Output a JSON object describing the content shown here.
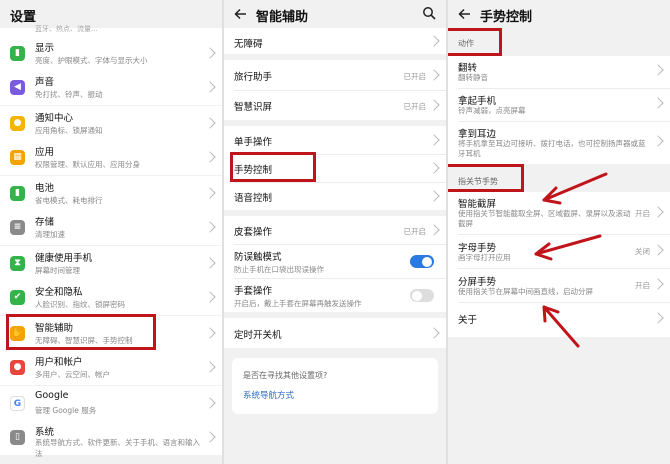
{
  "panel1": {
    "title": "设置",
    "top_fragment": "蓝牙、热点、流量...",
    "items": [
      {
        "title": "显示",
        "subtitle": "亮度、护眼模式、字体与显示大小",
        "icon": "display-icon",
        "color": "#33b34a"
      },
      {
        "title": "声音",
        "subtitle": "免打扰、铃声、振动",
        "icon": "sound-icon",
        "color": "#7a5ae0"
      },
      {
        "title": "通知中心",
        "subtitle": "应用角标、锁屏通知",
        "icon": "notification-icon",
        "color": "#f4b400"
      },
      {
        "title": "应用",
        "subtitle": "权限管理、默认应用、应用分身",
        "icon": "apps-icon",
        "color": "#f4a300"
      },
      {
        "title": "电池",
        "subtitle": "省电模式、耗电排行",
        "icon": "battery-icon",
        "color": "#33b34a"
      },
      {
        "title": "存储",
        "subtitle": "清理加速",
        "icon": "storage-icon",
        "color": "#8a8a8a"
      },
      {
        "title": "健康使用手机",
        "subtitle": "屏幕时间管理",
        "icon": "hourglass-icon",
        "color": "#33b34a"
      },
      {
        "title": "安全和隐私",
        "subtitle": "人脸识别、指纹、锁屏密码",
        "icon": "shield-icon",
        "color": "#33b34a"
      },
      {
        "title": "智能辅助",
        "subtitle": "无障碍、智慧识屏、手势控制",
        "icon": "hand-icon",
        "color": "#f4a300"
      },
      {
        "title": "用户和帐户",
        "subtitle": "多用户、云空间、帐户",
        "icon": "user-icon",
        "color": "#e8453c"
      },
      {
        "title": "Google",
        "subtitle": "管理 Google 服务",
        "icon": "google-icon",
        "color": "#ffffff"
      },
      {
        "title": "系统",
        "subtitle": "系统导航方式、软件更新、关于手机、语言和输入法",
        "icon": "system-icon",
        "color": "#8a8a8a"
      }
    ]
  },
  "panel2": {
    "title": "智能辅助",
    "items": [
      {
        "title": "无障碍"
      },
      {
        "title": "旅行助手",
        "value": "已开启"
      },
      {
        "title": "智慧识屏",
        "value": "已开启"
      },
      {
        "title": "单手操作"
      },
      {
        "title": "手势控制"
      },
      {
        "title": "语音控制"
      },
      {
        "title": "皮套操作",
        "value": "已开启"
      },
      {
        "title": "防误触模式",
        "subtitle": "防止手机在口袋出现误操作",
        "toggle": true
      },
      {
        "title": "手套操作",
        "subtitle": "开启后，戴上手套在屏幕再触发送操作",
        "toggle": false
      },
      {
        "title": "定时开关机"
      }
    ],
    "hint": "是否在寻找其他设置项?",
    "hint_link": "系统导航方式"
  },
  "panel3": {
    "title": "手势控制",
    "section1": "动作",
    "actions": [
      {
        "title": "翻转",
        "subtitle": "翻转静音"
      },
      {
        "title": "拿起手机",
        "subtitle": "铃声减弱，点亮屏幕"
      },
      {
        "title": "拿到耳边",
        "subtitle": "将手机拿至耳边可接听、拨打电话，也可控制扬声器或蓝牙耳机"
      }
    ],
    "section2": "指关节手势",
    "knuckles": [
      {
        "title": "智能截屏",
        "subtitle": "使用指关节智能截取全屏、区域截屏、录屏以及滚动截屏",
        "value": "开启"
      },
      {
        "title": "字母手势",
        "subtitle": "画字母打开应用",
        "value": "关闭"
      },
      {
        "title": "分屏手势",
        "subtitle": "使用指关节在屏幕中间画直线，启动分屏",
        "value": "开启"
      },
      {
        "title": "关于"
      }
    ]
  },
  "colors": {
    "accent": "#2a7ae2",
    "highlight": "#c0141b"
  }
}
